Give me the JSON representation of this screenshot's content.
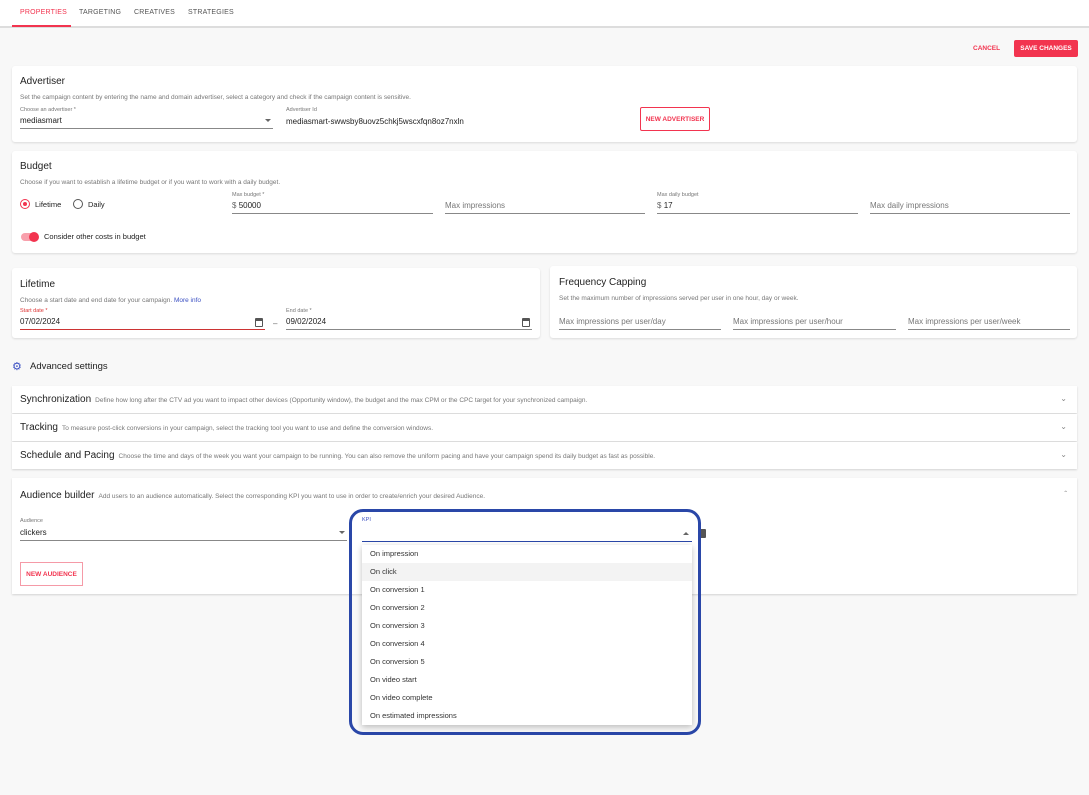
{
  "tabs": [
    "PROPERTIES",
    "TARGETING",
    "CREATIVES",
    "STRATEGIES"
  ],
  "actions": {
    "cancel": "CANCEL",
    "save": "SAVE CHANGES"
  },
  "advertiser": {
    "title": "Advertiser",
    "desc": "Set the campaign content by entering the name and domain advertiser, select a category and check if the campaign content is sensitive.",
    "choose_label": "Choose an advertiser *",
    "choose_value": "mediasmart",
    "id_label": "Advertiser Id",
    "id_value": "mediasmart-swwsby8uovz5chkj5wscxfqn8oz7nxln",
    "new_button": "NEW ADVERTISER"
  },
  "budget": {
    "title": "Budget",
    "desc": "Choose if you want to establish a lifetime budget or if you want to work with a daily budget.",
    "radio_lifetime": "Lifetime",
    "radio_daily": "Daily",
    "selected": "Lifetime",
    "max_budget_label": "Max budget *",
    "currency": "$",
    "max_budget": "50000",
    "max_impressions_ph": "Max impressions",
    "max_daily_label": "Max daily budget",
    "max_daily": "17",
    "max_daily_impr_ph": "Max daily impressions",
    "toggle_label": "Consider other costs in budget",
    "toggle_on": true
  },
  "lifetime": {
    "title": "Lifetime",
    "desc": "Choose a start date and end date for your campaign.",
    "more_info": "More info",
    "start_label": "Start date *",
    "start": "07/02/2024",
    "sep": "–",
    "end_label": "End date *",
    "end": "09/02/2024"
  },
  "frequency": {
    "title": "Frequency Capping",
    "desc": "Set the maximum number of impressions served per user in one hour, day or week.",
    "day_ph": "Max impressions per user/day",
    "hour_ph": "Max impressions per user/hour",
    "week_ph": "Max impressions per user/week"
  },
  "advanced": {
    "title": "Advanced settings"
  },
  "sections": [
    {
      "title": "Synchronization",
      "desc": "Define how long after the CTV ad you want to impact other devices (Opportunity window), the budget and the max CPM or the CPC target for your synchronized campaign."
    },
    {
      "title": "Tracking",
      "desc": "To measure post-click conversions in your campaign, select the tracking tool you want to use and define the conversion windows."
    },
    {
      "title": "Schedule and Pacing",
      "desc": "Choose the time and days of the week you want your campaign to be running. You can also remove the uniform pacing and have your campaign spend its daily budget as fast as possible."
    }
  ],
  "audience": {
    "title": "Audience builder",
    "desc": "Add users to an audience automatically. Select the corresponding KPI you want to use in order to create/enrich your desired Audience.",
    "audience_label": "Audience",
    "audience_value": "clickers",
    "kpi_label": "KPI",
    "new_button": "NEW AUDIENCE"
  },
  "kpi_options": [
    "On impression",
    "On click",
    "On conversion 1",
    "On conversion 2",
    "On conversion 3",
    "On conversion 4",
    "On conversion 5",
    "On video start",
    "On video complete",
    "On estimated impressions"
  ],
  "kpi_highlighted": "On click",
  "colors": {
    "accent": "#f2344f",
    "focus": "#2a47a8"
  }
}
